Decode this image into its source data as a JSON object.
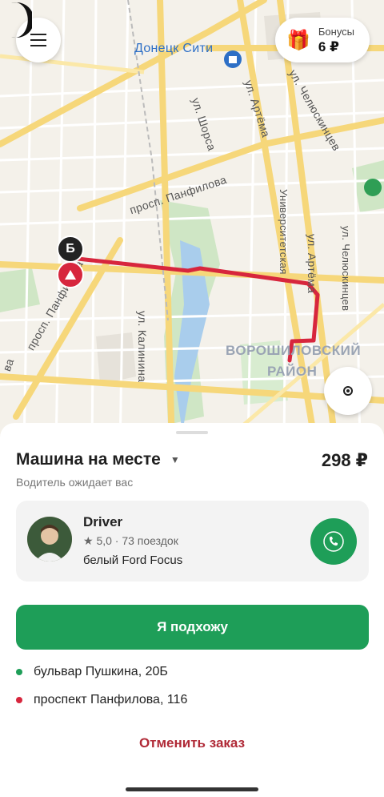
{
  "map": {
    "poi_label": "Донецк Сити",
    "district_label_line1": "ВОРОШИЛОВСКИЙ",
    "district_label_line2": "РАЙОН",
    "streets": {
      "shorsa": "ул. Шорса",
      "artema1": "ул. Артёма",
      "artema2": "ул. Артёма",
      "chelyuskintsev1": "ул. Челюскинцев",
      "chelyuskintsev2": "ул. Челюскинцев",
      "panfilova_prospect": "просп. Панфилова",
      "panfilova_prospect2": "просп. Панфилова",
      "universitetskaya": "Университетская",
      "kalinina": "ул. Калинина",
      "partial_a": "ва"
    },
    "pin_b_label": "Б",
    "route_color": "#d7263d"
  },
  "header": {
    "bonus_label": "Бонусы",
    "bonus_value": "6 ₽"
  },
  "order": {
    "status_title": "Машина на месте",
    "status_subtitle": "Водитель ожидает вас",
    "price": "298 ₽"
  },
  "driver": {
    "name": "Driver",
    "rating": "★ 5,0 · 73 поездок",
    "car": "белый Ford Focus"
  },
  "actions": {
    "primary": "Я подхожу",
    "cancel": "Отменить заказ"
  },
  "route": {
    "from": "бульвар Пушкина, 20Б",
    "to": "проспект Панфилова, 116",
    "from_color": "#1e9e58",
    "to_color": "#d7263d"
  },
  "colors": {
    "accent": "#1e9e58",
    "danger": "#b02a37"
  }
}
